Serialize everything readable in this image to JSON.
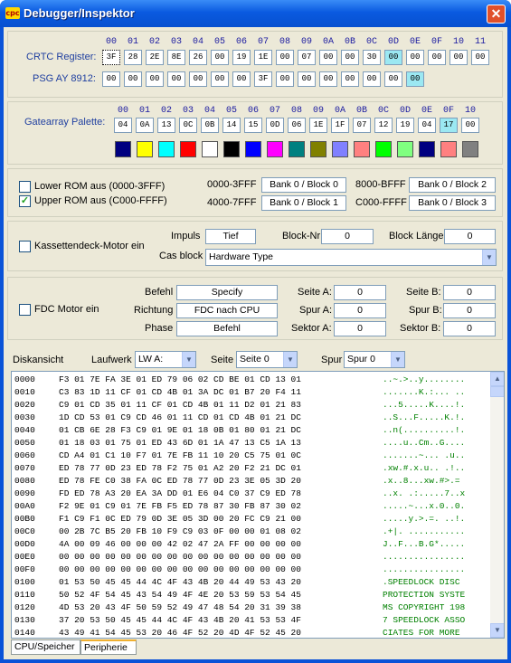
{
  "window": {
    "title": "Debugger/Inspektor",
    "icon_text": "cpc"
  },
  "crtc": {
    "label": "CRTC Register:",
    "headers": [
      "00",
      "01",
      "02",
      "03",
      "04",
      "05",
      "06",
      "07",
      "08",
      "09",
      "0A",
      "0B",
      "0C",
      "0D",
      "0E",
      "0F",
      "10",
      "11"
    ],
    "values": [
      "3F",
      "28",
      "2E",
      "8E",
      "26",
      "00",
      "19",
      "1E",
      "00",
      "07",
      "00",
      "00",
      "30",
      "00",
      "00",
      "00",
      "00",
      "00"
    ],
    "highlighted_index": 13
  },
  "psg": {
    "label": "PSG AY 8912:",
    "values": [
      "00",
      "00",
      "00",
      "00",
      "00",
      "00",
      "00",
      "3F",
      "00",
      "00",
      "00",
      "00",
      "00",
      "00",
      "00"
    ],
    "highlighted_index": 14
  },
  "gatearray": {
    "label": "Gatearray Palette:",
    "headers": [
      "00",
      "01",
      "02",
      "03",
      "04",
      "05",
      "06",
      "07",
      "08",
      "09",
      "0A",
      "0B",
      "0C",
      "0D",
      "0E",
      "0F",
      "10"
    ],
    "values": [
      "04",
      "0A",
      "13",
      "0C",
      "0B",
      "14",
      "15",
      "0D",
      "06",
      "1E",
      "1F",
      "07",
      "12",
      "19",
      "04",
      "17",
      "00"
    ],
    "highlighted_index": 15,
    "colors": [
      "#000080",
      "#ffff00",
      "#00ffff",
      "#ff0000",
      "#ffffff",
      "#000000",
      "#0000ff",
      "#ff00ff",
      "#008080",
      "#808000",
      "#8080ff",
      "#ff8080",
      "#00ff00",
      "#80ff80",
      "#000080",
      "#ff8080",
      "#808080"
    ]
  },
  "rom": {
    "lower_label": "Lower ROM aus (0000-3FFF)",
    "lower_checked": false,
    "upper_label": "Upper ROM aus (C000-FFFF)",
    "upper_checked": true,
    "banks": [
      {
        "range": "0000-3FFF",
        "value": "Bank 0 / Block 0"
      },
      {
        "range": "4000-7FFF",
        "value": "Bank 0 / Block 1"
      },
      {
        "range": "8000-BFFF",
        "value": "Bank 0 / Block 2"
      },
      {
        "range": "C000-FFFF",
        "value": "Bank 0 / Block 3"
      }
    ]
  },
  "tape": {
    "motor_label": "Kassettendeck-Motor ein",
    "impuls_label": "Impuls",
    "impuls_value": "Tief",
    "block_nr_label": "Block-Nr",
    "block_nr_value": "0",
    "block_len_label": "Block Länge",
    "block_len_value": "0",
    "cas_block_label": "Cas block",
    "cas_block_value": "Hardware Type"
  },
  "fdc": {
    "motor_label": "FDC Motor ein",
    "befehl_label": "Befehl",
    "befehl_value": "Specify",
    "richtung_label": "Richtung",
    "richtung_value": "FDC nach CPU",
    "phase_label": "Phase",
    "phase_value": "Befehl",
    "seite_a_label": "Seite A:",
    "seite_a_value": "0",
    "spur_a_label": "Spur A:",
    "spur_a_value": "0",
    "sektor_a_label": "Sektor A:",
    "sektor_a_value": "0",
    "seite_b_label": "Seite B:",
    "seite_b_value": "0",
    "spur_b_label": "Spur B:",
    "spur_b_value": "0",
    "sektor_b_label": "Sektor B:",
    "sektor_b_value": "0"
  },
  "disk": {
    "label": "Diskansicht",
    "laufwerk_label": "Laufwerk",
    "laufwerk_value": "LW A:",
    "seite_label": "Seite",
    "seite_value": "Seite 0",
    "spur_label": "Spur",
    "spur_value": "Spur 0",
    "rows": [
      {
        "addr": "0000",
        "bytes": "F3 01 7E FA 3E 01 ED 79 06 02 CD BE 01 CD 13 01",
        "ascii": "..~.>..y........"
      },
      {
        "addr": "0010",
        "bytes": "C3 83 1D 11 CF 01 CD 4B 01 3A DC 01 B7 20 F4 11",
        "ascii": ".......K.:... .."
      },
      {
        "addr": "0020",
        "bytes": "C9 01 CD 35 01 11 CF 01 CD 4B 01 11 D2 01 21 83",
        "ascii": "...5.....K....!."
      },
      {
        "addr": "0030",
        "bytes": "1D CD 53 01 C9 CD 46 01 11 CD 01 CD 4B 01 21 DC",
        "ascii": "..S...F.....K.!."
      },
      {
        "addr": "0040",
        "bytes": "01 CB 6E 28 F3 C9 01 9E 01 18 0B 01 80 01 21 DC",
        "ascii": "..n(..........!."
      },
      {
        "addr": "0050",
        "bytes": "01 18 03 01 75 01 ED 43 6D 01 1A 47 13 C5 1A 13",
        "ascii": "....u..Cm..G...."
      },
      {
        "addr": "0060",
        "bytes": "CD A4 01 C1 10 F7 01 7E FB 11 10 20 C5 75 01 0C",
        "ascii": ".......~... .u.."
      },
      {
        "addr": "0070",
        "bytes": "ED 78 77 0D 23 ED 78 F2 75 01 A2 20 F2 21 DC 01",
        "ascii": ".xw.#.x.u.. .!.."
      },
      {
        "addr": "0080",
        "bytes": "ED 78 FE C0 38 FA 0C ED 78 77 0D 23 3E 05 3D 20",
        "ascii": ".x..8...xw.#>.= "
      },
      {
        "addr": "0090",
        "bytes": "FD ED 78 A3 20 EA 3A DD 01 E6 04 C0 37 C9 ED 78",
        "ascii": "..x. .:.....7..x"
      },
      {
        "addr": "00A0",
        "bytes": "F2 9E 01 C9 01 7E FB F5 ED 78 87 30 FB 87 30 02",
        "ascii": ".....~...x.0..0."
      },
      {
        "addr": "00B0",
        "bytes": "F1 C9 F1 0C ED 79 0D 3E 05 3D 00 20 FC C9 21 00",
        "ascii": ".....y.>.=. ..!."
      },
      {
        "addr": "00C0",
        "bytes": "00 2B 7C B5 20 FB 10 F9 C9 03 0F 00 00 01 08 02",
        "ascii": ".+|. ..........."
      },
      {
        "addr": "00D0",
        "bytes": "4A 00 09 46 00 00 00 42 02 47 2A FF 00 00 00 00",
        "ascii": "J..F...B.G*....."
      },
      {
        "addr": "00E0",
        "bytes": "00 00 00 00 00 00 00 00 00 00 00 00 00 00 00 00",
        "ascii": "................"
      },
      {
        "addr": "00F0",
        "bytes": "00 00 00 00 00 00 00 00 00 00 00 00 00 00 00 00",
        "ascii": "................"
      },
      {
        "addr": "0100",
        "bytes": "01 53 50 45 45 44 4C 4F 43 4B 20 44 49 53 43 20",
        "ascii": ".SPEEDLOCK DISC "
      },
      {
        "addr": "0110",
        "bytes": "50 52 4F 54 45 43 54 49 4F 4E 20 53 59 53 54 45",
        "ascii": "PROTECTION SYSTE"
      },
      {
        "addr": "0120",
        "bytes": "4D 53 20 43 4F 50 59 52 49 47 48 54 20 31 39 38",
        "ascii": "MS COPYRIGHT 198"
      },
      {
        "addr": "0130",
        "bytes": "37 20 53 50 45 45 44 4C 4F 43 4B 20 41 53 53 4F",
        "ascii": "7 SPEEDLOCK ASSO"
      },
      {
        "addr": "0140",
        "bytes": "43 49 41 54 45 53 20 46 4F 52 20 4D 4F 52 45 20",
        "ascii": "CIATES FOR MORE "
      }
    ]
  },
  "tabs": [
    {
      "label": "CPU/Speicher",
      "active": false
    },
    {
      "label": "Peripherie",
      "active": true
    }
  ]
}
